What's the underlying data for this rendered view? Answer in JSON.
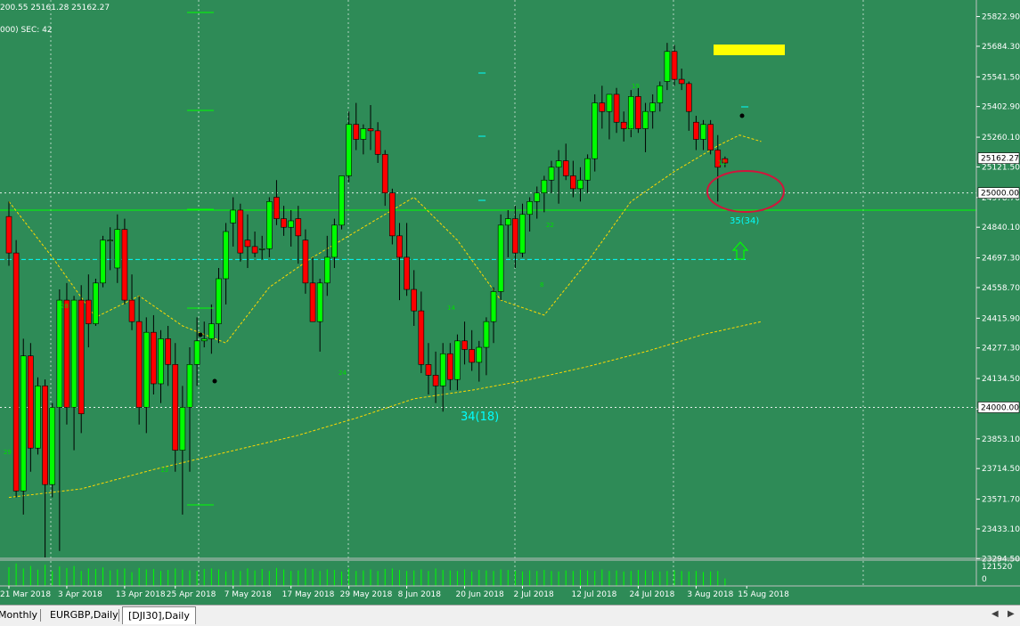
{
  "header": {
    "ohlc_text": "200.55 25161.28 25162.27",
    "info_text": "000) SEC: 42"
  },
  "price_axis": {
    "ticks": [
      "25822.90",
      "25684.30",
      "25541.50",
      "25402.90",
      "25260.10",
      "25121.50",
      "24978.70",
      "24840.10",
      "24697.30",
      "24558.70",
      "24415.90",
      "24277.30",
      "24134.50",
      "23991.70",
      "23853.10",
      "23714.50",
      "23571.70",
      "23433.10",
      "23294.50"
    ],
    "current_price": "25162.27",
    "level_25000": "25000.00",
    "level_24000": "24000.00"
  },
  "volume_axis": {
    "max_label": "121520",
    "min_label": "0"
  },
  "time_axis": {
    "labels": [
      "21 Mar 2018",
      "3 Apr 2018",
      "13 Apr 2018",
      "25 Apr 2018",
      "7 May 2018",
      "17 May 2018",
      "29 May 2018",
      "8 Jun 2018",
      "20 Jun 2018",
      "2 Jul 2018",
      "12 Jul 2018",
      "24 Jul 2018",
      "3 Aug 2018",
      "15 Aug 2018"
    ]
  },
  "annotations": {
    "swing_low_label": "34(18)",
    "current_label": "35(34)",
    "small_numbers": [
      "29",
      "13",
      "28",
      "24",
      "14",
      "8",
      "22",
      "19",
      "10",
      "11"
    ]
  },
  "tabs": {
    "items": [
      "Monthly",
      "EURGBP,Daily",
      "[DJI30],Daily"
    ],
    "active_index": 2
  },
  "colors": {
    "background": "#2e8b57",
    "bull": "#00ff00",
    "bear": "#ff0000",
    "wick": "#000000",
    "grid": "#ffffff",
    "ma_fast": "#ffd700",
    "ma_slow": "#ffd700",
    "support_line": "#00ff00",
    "cyan_line": "#00ffff",
    "circle": "#d2143c",
    "highlight_box": "#ffff00"
  },
  "chart_data": {
    "type": "candlestick",
    "y_range": [
      23300,
      25900
    ],
    "horizontal_levels": [
      25000,
      24000,
      24920,
      24690
    ],
    "candles": [
      [
        24890,
        24960,
        24660,
        24720
      ],
      [
        24720,
        24780,
        23580,
        23610
      ],
      [
        23610,
        24320,
        23500,
        24240
      ],
      [
        24240,
        24300,
        23700,
        23810
      ],
      [
        23810,
        24140,
        23780,
        24100
      ],
      [
        24100,
        24130,
        23300,
        23640
      ],
      [
        23640,
        24020,
        23580,
        24000
      ],
      [
        24000,
        24550,
        23330,
        24500
      ],
      [
        24500,
        24580,
        23920,
        24000
      ],
      [
        24000,
        24520,
        23800,
        24500
      ],
      [
        24500,
        24570,
        23880,
        23970
      ],
      [
        24500,
        24620,
        24280,
        24390
      ],
      [
        24390,
        24600,
        24380,
        24580
      ],
      [
        24580,
        24800,
        24560,
        24780
      ],
      [
        24780,
        24840,
        24640,
        24780
      ],
      [
        24650,
        24900,
        24580,
        24830
      ],
      [
        24830,
        24880,
        24480,
        24500
      ],
      [
        24500,
        24620,
        24360,
        24400
      ],
      [
        24400,
        24520,
        23920,
        24000
      ],
      [
        24000,
        24420,
        23880,
        24350
      ],
      [
        24350,
        24430,
        24060,
        24110
      ],
      [
        24110,
        24360,
        24020,
        24320
      ],
      [
        24320,
        24380,
        24100,
        24200
      ],
      [
        24200,
        24300,
        23700,
        23800
      ],
      [
        23800,
        24100,
        23500,
        24000
      ],
      [
        24000,
        24280,
        23700,
        24200
      ],
      [
        24200,
        24420,
        24100,
        24310
      ],
      [
        24310,
        24400,
        24280,
        24320
      ],
      [
        24320,
        24480,
        24250,
        24390
      ],
      [
        24390,
        24650,
        24300,
        24600
      ],
      [
        24600,
        24860,
        24480,
        24820
      ],
      [
        24860,
        24980,
        24750,
        24920
      ],
      [
        24920,
        24950,
        24680,
        24720
      ],
      [
        24780,
        24900,
        24650,
        24750
      ],
      [
        24750,
        24820,
        24700,
        24720
      ],
      [
        24740,
        24800,
        24690,
        24740
      ],
      [
        24740,
        24980,
        24700,
        24960
      ],
      [
        24980,
        25060,
        24850,
        24880
      ],
      [
        24880,
        24940,
        24800,
        24840
      ],
      [
        24840,
        24920,
        24750,
        24870
      ],
      [
        24880,
        24940,
        24670,
        24800
      ],
      [
        24780,
        24830,
        24530,
        24580
      ],
      [
        24580,
        24700,
        24460,
        24400
      ],
      [
        24400,
        24600,
        24260,
        24580
      ],
      [
        24580,
        24800,
        24520,
        24700
      ],
      [
        24700,
        24880,
        24650,
        24850
      ],
      [
        24850,
        25070,
        24830,
        25080
      ],
      [
        25080,
        25380,
        25050,
        25320
      ],
      [
        25320,
        25420,
        25200,
        25250
      ],
      [
        25250,
        25320,
        25180,
        25300
      ],
      [
        25300,
        25410,
        25200,
        25290
      ],
      [
        25290,
        25330,
        25140,
        25180
      ],
      [
        25180,
        25200,
        24940,
        25000
      ],
      [
        25000,
        25020,
        24760,
        24800
      ],
      [
        24800,
        24860,
        24500,
        24700
      ],
      [
        24700,
        24860,
        24520,
        24550
      ],
      [
        24550,
        24640,
        24380,
        24450
      ],
      [
        24450,
        24540,
        24160,
        24200
      ],
      [
        24200,
        24300,
        24060,
        24150
      ],
      [
        24150,
        24260,
        24020,
        24100
      ],
      [
        24100,
        24300,
        23980,
        24250
      ],
      [
        24250,
        24300,
        24080,
        24130
      ],
      [
        24130,
        24340,
        24080,
        24310
      ],
      [
        24310,
        24400,
        24200,
        24270
      ],
      [
        24270,
        24360,
        24170,
        24210
      ],
      [
        24210,
        24310,
        24120,
        24280
      ],
      [
        24280,
        24420,
        24150,
        24400
      ],
      [
        24400,
        24560,
        24300,
        24540
      ],
      [
        24540,
        24900,
        24500,
        24850
      ],
      [
        24850,
        24920,
        24700,
        24880
      ],
      [
        24880,
        24940,
        24650,
        24720
      ],
      [
        24720,
        24950,
        24700,
        24900
      ],
      [
        24900,
        24980,
        24820,
        24960
      ],
      [
        24960,
        25030,
        24880,
        25000
      ],
      [
        25000,
        25080,
        24910,
        25060
      ],
      [
        25060,
        25150,
        25000,
        25120
      ],
      [
        25120,
        25200,
        24950,
        25150
      ],
      [
        25150,
        25230,
        25060,
        25080
      ],
      [
        25080,
        25150,
        24980,
        25020
      ],
      [
        25020,
        25120,
        24960,
        25060
      ],
      [
        25060,
        25180,
        25000,
        25160
      ],
      [
        25160,
        25460,
        25100,
        25420
      ],
      [
        25420,
        25500,
        25300,
        25380
      ],
      [
        25380,
        25460,
        25250,
        25460
      ],
      [
        25460,
        25490,
        25280,
        25330
      ],
      [
        25330,
        25380,
        25240,
        25300
      ],
      [
        25300,
        25480,
        25260,
        25450
      ],
      [
        25450,
        25490,
        25280,
        25300
      ],
      [
        25300,
        25420,
        25190,
        25380
      ],
      [
        25380,
        25460,
        25300,
        25420
      ],
      [
        25420,
        25520,
        25380,
        25500
      ],
      [
        25520,
        25700,
        25480,
        25660
      ],
      [
        25660,
        25690,
        25500,
        25530
      ],
      [
        25530,
        25580,
        25480,
        25510
      ],
      [
        25510,
        25520,
        25290,
        25380
      ],
      [
        25330,
        25360,
        25200,
        25250
      ],
      [
        25250,
        25340,
        25200,
        25320
      ],
      [
        25320,
        25340,
        25180,
        25200
      ],
      [
        25200,
        25270,
        24960,
        25120
      ],
      [
        25160,
        25170,
        25120,
        25140
      ]
    ],
    "ma_fast": [
      [
        0,
        24960
      ],
      [
        6,
        24700
      ],
      [
        12,
        24420
      ],
      [
        18,
        24520
      ],
      [
        24,
        24380
      ],
      [
        30,
        24300
      ],
      [
        36,
        24560
      ],
      [
        42,
        24700
      ],
      [
        48,
        24820
      ],
      [
        56,
        24980
      ],
      [
        62,
        24780
      ],
      [
        68,
        24500
      ],
      [
        74,
        24430
      ],
      [
        80,
        24680
      ],
      [
        86,
        24960
      ],
      [
        92,
        25100
      ],
      [
        98,
        25220
      ],
      [
        101,
        25270
      ],
      [
        104,
        25240
      ]
    ],
    "ma_slow": [
      [
        0,
        23580
      ],
      [
        10,
        23620
      ],
      [
        20,
        23710
      ],
      [
        30,
        23790
      ],
      [
        40,
        23870
      ],
      [
        48,
        23950
      ],
      [
        56,
        24040
      ],
      [
        64,
        24080
      ],
      [
        72,
        24130
      ],
      [
        80,
        24190
      ],
      [
        88,
        24260
      ],
      [
        96,
        24340
      ],
      [
        104,
        24400
      ]
    ],
    "volume": [
      0.75,
      0.9,
      0.7,
      0.8,
      0.65,
      0.85,
      0.6,
      0.78,
      0.72,
      0.8,
      0.6,
      0.7,
      0.68,
      0.74,
      0.62,
      0.66,
      0.7,
      0.55,
      0.72,
      0.66,
      0.68,
      0.6,
      0.64,
      0.7,
      0.65,
      0.62,
      0.6,
      0.68,
      0.7,
      0.66,
      0.58,
      0.64,
      0.6,
      0.7,
      0.62,
      0.68,
      0.6,
      0.72,
      0.66,
      0.6,
      0.62,
      0.7,
      0.68,
      0.6,
      0.66,
      0.64,
      0.58,
      0.7,
      0.6,
      0.62,
      0.66,
      0.6,
      0.68,
      0.7,
      0.64,
      0.6,
      0.62,
      0.66,
      0.6,
      0.7,
      0.64,
      0.62,
      0.6,
      0.66,
      0.58,
      0.64,
      0.62,
      0.6,
      0.66,
      0.64,
      0.6,
      0.58,
      0.62,
      0.6,
      0.64,
      0.6,
      0.58,
      0.62,
      0.6,
      0.64,
      0.62,
      0.6,
      0.66,
      0.6,
      0.62,
      0.58,
      0.6,
      0.64,
      0.62,
      0.6,
      0.58,
      0.6,
      0.62,
      0.6,
      0.58,
      0.6,
      0.56,
      0.58,
      0.6,
      0.3
    ]
  }
}
